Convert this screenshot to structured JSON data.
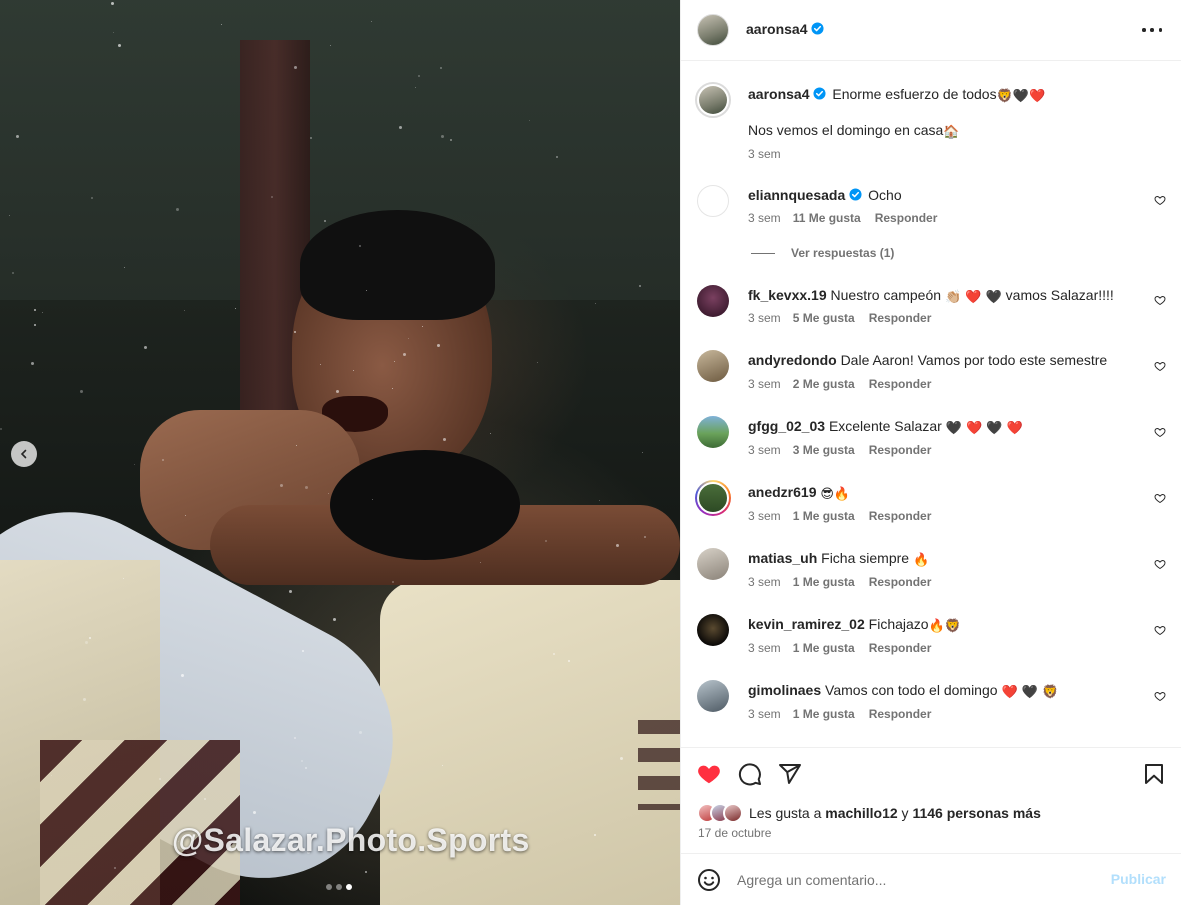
{
  "post": {
    "author": "aaronsa4",
    "verified": true
  },
  "photo": {
    "watermark": "@Salazar.Photo.Sports",
    "carousel_dots": 3,
    "active_dot": 3
  },
  "caption": {
    "username": "aaronsa4",
    "line1": "Enorme esfuerzo de todos",
    "line1_emojis": [
      "🦁",
      "🖤",
      "❤️"
    ],
    "line2": "Nos vemos el domingo en casa",
    "line2_emojis": [
      "🏠"
    ],
    "time": "3 sem"
  },
  "comments": [
    {
      "username": "eliannquesada",
      "verified": true,
      "text": "Ocho",
      "time": "3 sem",
      "likes": "11 Me gusta",
      "reply": "Responder"
    },
    {
      "username": "fk_kevxx.19",
      "text": "Nuestro campeón",
      "emojis": "👏🏼 ❤️ 🖤",
      "text_after": "vamos Salazar!!!!",
      "time": "3 sem",
      "likes": "5 Me gusta",
      "reply": "Responder"
    },
    {
      "username": "andyredondo",
      "text": "Dale Aaron! Vamos por todo este semestre",
      "time": "3 sem",
      "likes": "2 Me gusta",
      "reply": "Responder"
    },
    {
      "username": "gfgg_02_03",
      "text": "Excelente Salazar",
      "emojis": "🖤 ❤️ 🖤 ❤️",
      "time": "3 sem",
      "likes": "3 Me gusta",
      "reply": "Responder"
    },
    {
      "username": "anedzr619",
      "text": "",
      "emojis": "😎🔥",
      "time": "3 sem",
      "likes": "1 Me gusta",
      "reply": "Responder"
    },
    {
      "username": "matias_uh",
      "text": "Ficha siempre",
      "emojis": "🔥",
      "time": "3 sem",
      "likes": "1 Me gusta",
      "reply": "Responder"
    },
    {
      "username": "kevin_ramirez_02",
      "text": "Fichajazo",
      "emojis": "🔥🦁",
      "time": "3 sem",
      "likes": "1 Me gusta",
      "reply": "Responder"
    },
    {
      "username": "gimolinaes",
      "text": "Vamos con todo el domingo",
      "emojis": "❤️ 🖤 🦁",
      "time": "3 sem",
      "likes": "1 Me gusta",
      "reply": "Responder"
    }
  ],
  "view_replies": "Ver respuestas (1)",
  "likes": {
    "prefix": "Les gusta a",
    "user": "machillo12",
    "joiner": "y",
    "others": "1146 personas más"
  },
  "date": "17 de octubre",
  "add_comment": {
    "placeholder": "Agrega un comentario...",
    "publish": "Publicar"
  },
  "colors": {
    "like_red": "#ff3040",
    "verified_blue": "#0095f6",
    "publish_disabled": "#b2dffc",
    "muted_text": "#737373"
  }
}
